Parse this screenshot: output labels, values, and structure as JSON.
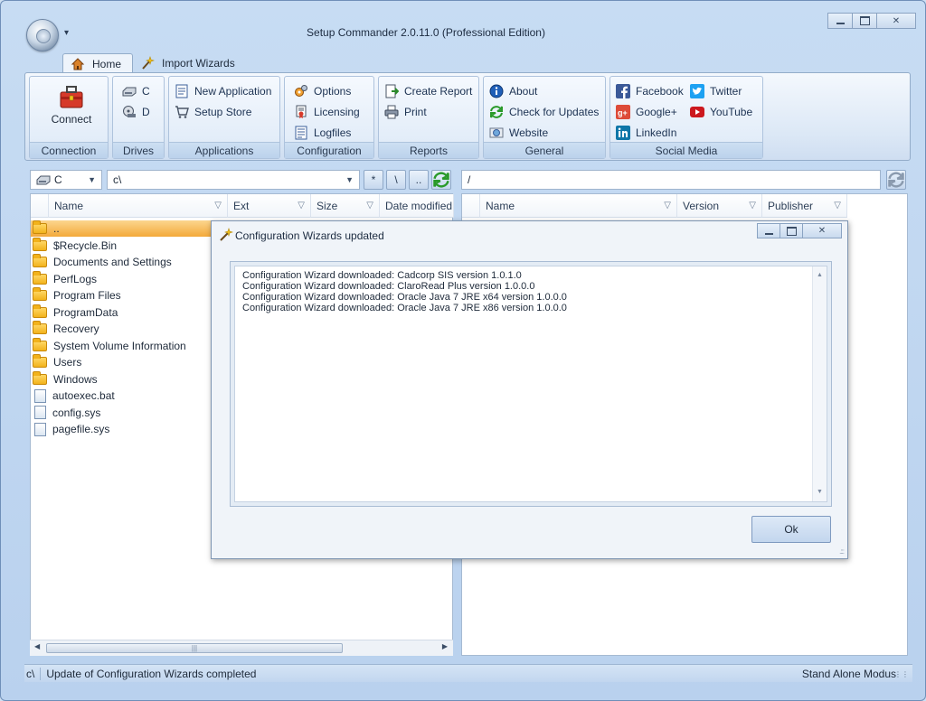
{
  "window": {
    "title": "Setup Commander 2.0.11.0 (Professional Edition)"
  },
  "ribbon_tabs": [
    {
      "label": "Home",
      "active": true
    },
    {
      "label": "Import Wizards",
      "active": false
    }
  ],
  "ribbon": {
    "connection": {
      "connect": "Connect",
      "group": "Connection"
    },
    "drives": {
      "c": "C",
      "d": "D",
      "group": "Drives"
    },
    "applications": {
      "new_application": "New Application",
      "setup_store": "Setup Store",
      "group": "Applications"
    },
    "configuration": {
      "options": "Options",
      "licensing": "Licensing",
      "logfiles": "Logfiles",
      "group": "Configuration"
    },
    "reports": {
      "create_report": "Create Report",
      "print": "Print",
      "group": "Reports"
    },
    "general": {
      "about": "About",
      "check_updates": "Check for Updates",
      "website": "Website",
      "group": "General"
    },
    "social": {
      "facebook": "Facebook",
      "twitter": "Twitter",
      "google": "Google+",
      "youtube": "YouTube",
      "linkedin": "LinkedIn",
      "group": "Social Media"
    }
  },
  "left_pane": {
    "drive": "C",
    "path": "c\\",
    "filter_buttons": [
      "*",
      "\\",
      ".."
    ],
    "columns": [
      "Name",
      "Ext",
      "Size",
      "Date modified"
    ],
    "files": [
      {
        "name": "..",
        "type": "up"
      },
      {
        "name": "$Recycle.Bin",
        "type": "folder"
      },
      {
        "name": "Documents and Settings",
        "type": "folder"
      },
      {
        "name": "PerfLogs",
        "type": "folder"
      },
      {
        "name": "Program Files",
        "type": "folder"
      },
      {
        "name": "ProgramData",
        "type": "folder"
      },
      {
        "name": "Recovery",
        "type": "folder"
      },
      {
        "name": "System Volume Information",
        "type": "folder"
      },
      {
        "name": "Users",
        "type": "folder"
      },
      {
        "name": "Windows",
        "type": "folder"
      },
      {
        "name": "autoexec.bat",
        "type": "file"
      },
      {
        "name": "config.sys",
        "type": "file"
      },
      {
        "name": "pagefile.sys",
        "type": "file"
      }
    ]
  },
  "right_pane": {
    "path": "/",
    "columns": [
      "Name",
      "Version",
      "Publisher"
    ]
  },
  "dialog": {
    "title": "Configuration Wizards updated",
    "log_lines": [
      "Configuration Wizard downloaded: Cadcorp SIS version 1.0.1.0",
      "Configuration Wizard downloaded: ClaroRead Plus version 1.0.0.0",
      "Configuration Wizard downloaded: Oracle Java 7 JRE x64 version 1.0.0.0",
      "Configuration Wizard downloaded: Oracle Java 7 JRE x86 version 1.0.0.0"
    ],
    "ok": "Ok"
  },
  "status": {
    "path": "c\\",
    "message": "Update of Configuration Wizards completed",
    "mode": "Stand Alone Modus"
  }
}
